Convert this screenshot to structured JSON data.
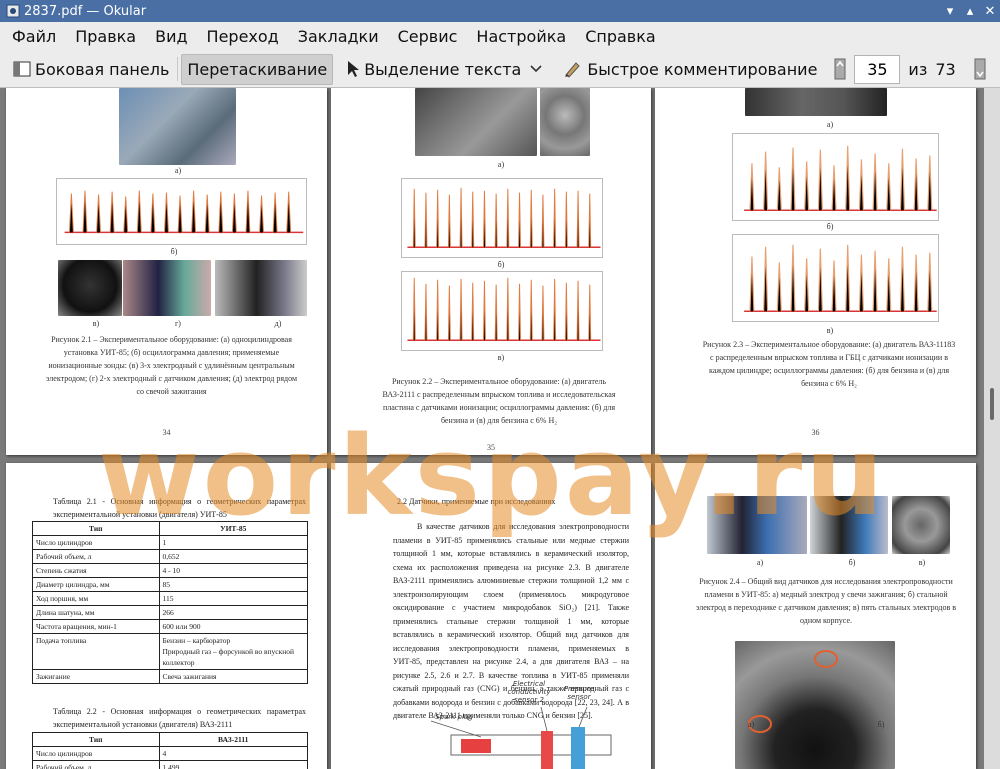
{
  "window": {
    "title": "2837.pdf  — Okular",
    "colors": {
      "titlebar": "#4a6fa5",
      "menubar": "#ececec",
      "viewer": "#7a7a7a"
    }
  },
  "menu": [
    "Файл",
    "Правка",
    "Вид",
    "Переход",
    "Закладки",
    "Сервис",
    "Настройка",
    "Справка"
  ],
  "toolbar": {
    "sidebar": "Боковая панель",
    "drag": "Перетаскивание",
    "text_select": "Выделение текста",
    "quick_annotate": "Быстрое комментирование",
    "page_current": "35",
    "page_of": "из",
    "page_total": "73"
  },
  "watermark": "workspay.ru",
  "pages": {
    "p34": {
      "label_a": "а)",
      "label_b": "б)",
      "label_v": "в)",
      "label_g": "г)",
      "label_d": "д)",
      "caption": "Рисунок 2.1 – Экспериментальное оборудование: (а) одноцилиндровая установка УИТ-85; (б) осциллограмма давления; применяемые ионизационные зонды: (в) 3-х электродный с удлинённым центральным электродом; (г) 2-х электродный с датчиком давления; (д) электрод рядом со свечой зажигания",
      "number": "34"
    },
    "p35": {
      "label_a": "а)",
      "label_b": "б)",
      "label_v": "в)",
      "caption": "Рисунок 2.2 – Экспериментальное оборудование: (а) двигатель ВАЗ-2111 с распределенным впрыском топлива и исследовательская пластина с датчиками ионизации; осциллограммы давления: (б) для бензина и (в) для бензина с 6% H₂",
      "number": "35"
    },
    "p36": {
      "label_a": "а)",
      "label_b": "б)",
      "label_v": "в)",
      "caption": "Рисунок 2.3 – Экспериментальное оборудование: (а) двигатель ВАЗ-11183 с распределенным впрыском топлива и ГБЦ с датчиками ионизации в каждом цилиндре; осциллограммы давления: (б) для бензина и (в) для бензина с 6% H₂",
      "number": "36"
    },
    "p37": {
      "table1_caption": "Таблица 2.1 - Основная информация о геометрических параметрах экспериментальной установки (двигателя) УИТ-85",
      "table1_head": [
        "Тип",
        "УИТ-85"
      ],
      "table1_rows": [
        [
          "Число цилиндров",
          "1"
        ],
        [
          "Рабочий объем, л",
          "0,652"
        ],
        [
          "Степень сжатия",
          "4 - 10"
        ],
        [
          "Диаметр цилиндра, мм",
          "85"
        ],
        [
          "Ход поршня, мм",
          "115"
        ],
        [
          "Длина шатуна, мм",
          "266"
        ],
        [
          "Частота вращения, мин-1",
          "600 или 900"
        ],
        [
          "Подача топлива",
          "Бензин – карбюратор\nПриродный газ – форсункой во впускной коллектор"
        ],
        [
          "Зажигание",
          "Свеча зажигания"
        ]
      ],
      "table2_caption": "Таблица 2.2 - Основная информация о геометрических параметрах экспериментальной установки (двигателя) ВАЗ-2111",
      "table2_head": [
        "Тип",
        "ВАЗ-2111"
      ],
      "table2_rows": [
        [
          "Число цилиндров",
          "4"
        ],
        [
          "Рабочий объем, л",
          "1,499"
        ]
      ]
    },
    "p38": {
      "heading": "2.2 Датчики, применяемые при исследованиях",
      "body": "В качестве датчиков для исследования электропроводности пламени в УИТ-85 применялись стальные или медные стержни толщиной 1 мм, которые вставлялись в керамический изолятор, схема их расположения приведена на рисунке 2.3. В двигателе ВАЗ-2111 применялись алюминиевые стержни толщиной 1,2 мм с электроизолирующим слоем (применялось микродуговое оксидирование с участием микродобавок SiO₂) [21]. Также применялись стальные стержни толщиной 1 мм, которые вставлялись в керамический изолятор. Общий вид датчиков для исследования электропроводности пламени, применяемых в УИТ-85, представлен на рисунке 2.4, а для двигателя ВАЗ – на рисунке 2.5, 2.6 и 2.7. В качестве топлива в УИТ-85 применяли сжатый природный газ (CNG) и бензин, а также природный газ с добавками водорода и бензин с добавками водорода [22, 23, 24]. А в двигателе ВАЗ-2111 применяли только CNG и бензин [25].",
      "diagram_labels": [
        "Electrical conductivity sensor 2",
        "Pressure sensor",
        "Spark plug"
      ]
    },
    "p39": {
      "label_a": "а)",
      "label_b": "б)",
      "label_v": "в)",
      "caption": "Рисунок 2.4 – Общий вид датчиков для исследования электропроводности пламени в УИТ-85: а) медный электрод у свечи зажигания; б) стальной электрод в переходнике с датчиком давления; в) пять стальных электродов в одном корпусе.",
      "photo_label_a": "а)",
      "photo_label_b": "б)"
    }
  }
}
